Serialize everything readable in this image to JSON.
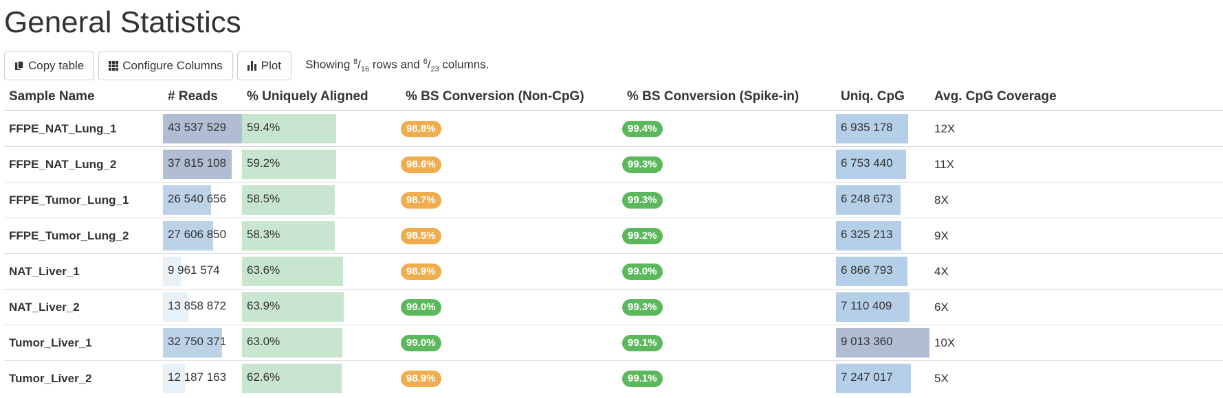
{
  "title": "General Statistics",
  "toolbar": {
    "copy_label": "Copy table",
    "configure_label": "Configure Columns",
    "plot_label": "Plot",
    "showing_prefix": "Showing ",
    "rows_shown": "8",
    "rows_total": "16",
    "rows_word": " rows and ",
    "cols_shown": "6",
    "cols_total": "23",
    "cols_word": " columns."
  },
  "columns": [
    "Sample Name",
    "# Reads",
    "% Uniquely Aligned",
    "% BS Conversion (Non-CpG)",
    "% BS Conversion (Spike-in)",
    "Uniq. CpG",
    "Avg. CpG Coverage"
  ],
  "colors": {
    "reads_bar_dark": "#b0bdd2",
    "reads_bar_mid": "#bcd2e6",
    "reads_bar_light": "#e8f0f8",
    "aligned_bar": "#c8e6cf",
    "cpg_bar": "#b5cfe8",
    "cpg_bar_max": "#b0bdd2",
    "badge_orange": "#f0ad4e",
    "badge_green": "#5cb85c"
  },
  "rows": [
    {
      "sample": "FFPE_NAT_Lung_1",
      "reads": "43 537 529",
      "reads_frac": 1.0,
      "reads_shade": "dark",
      "aligned": "59.4%",
      "aligned_frac": 0.594,
      "bs_noncpg": "98.8%",
      "noncpg_color": "orange",
      "bs_spike": "99.4%",
      "spike_color": "green",
      "uniq_cpg": "6 935 178",
      "cpg_frac": 0.77,
      "cpg_max": false,
      "coverage": "12X"
    },
    {
      "sample": "FFPE_NAT_Lung_2",
      "reads": "37 815 108",
      "reads_frac": 0.869,
      "reads_shade": "dark",
      "aligned": "59.2%",
      "aligned_frac": 0.592,
      "bs_noncpg": "98.6%",
      "noncpg_color": "orange",
      "bs_spike": "99.3%",
      "spike_color": "green",
      "uniq_cpg": "6 753 440",
      "cpg_frac": 0.749,
      "cpg_max": false,
      "coverage": "11X"
    },
    {
      "sample": "FFPE_Tumor_Lung_1",
      "reads": "26 540 656",
      "reads_frac": 0.61,
      "reads_shade": "mid",
      "aligned": "58.5%",
      "aligned_frac": 0.585,
      "bs_noncpg": "98.7%",
      "noncpg_color": "orange",
      "bs_spike": "99.3%",
      "spike_color": "green",
      "uniq_cpg": "6 248 673",
      "cpg_frac": 0.693,
      "cpg_max": false,
      "coverage": "8X"
    },
    {
      "sample": "FFPE_Tumor_Lung_2",
      "reads": "27 606 850",
      "reads_frac": 0.634,
      "reads_shade": "mid",
      "aligned": "58.3%",
      "aligned_frac": 0.583,
      "bs_noncpg": "98.5%",
      "noncpg_color": "orange",
      "bs_spike": "99.2%",
      "spike_color": "green",
      "uniq_cpg": "6 325 213",
      "cpg_frac": 0.702,
      "cpg_max": false,
      "coverage": "9X"
    },
    {
      "sample": "NAT_Liver_1",
      "reads": "9 961 574",
      "reads_frac": 0.229,
      "reads_shade": "light",
      "aligned": "63.6%",
      "aligned_frac": 0.636,
      "bs_noncpg": "98.9%",
      "noncpg_color": "orange",
      "bs_spike": "99.0%",
      "spike_color": "green",
      "uniq_cpg": "6 866 793",
      "cpg_frac": 0.762,
      "cpg_max": false,
      "coverage": "4X"
    },
    {
      "sample": "NAT_Liver_2",
      "reads": "13 858 872",
      "reads_frac": 0.318,
      "reads_shade": "light",
      "aligned": "63.9%",
      "aligned_frac": 0.639,
      "bs_noncpg": "99.0%",
      "noncpg_color": "green",
      "bs_spike": "99.3%",
      "spike_color": "green",
      "uniq_cpg": "7 110 409",
      "cpg_frac": 0.789,
      "cpg_max": false,
      "coverage": "6X"
    },
    {
      "sample": "Tumor_Liver_1",
      "reads": "32 750 371",
      "reads_frac": 0.752,
      "reads_shade": "mid",
      "aligned": "63.0%",
      "aligned_frac": 0.63,
      "bs_noncpg": "99.0%",
      "noncpg_color": "green",
      "bs_spike": "99.1%",
      "spike_color": "green",
      "uniq_cpg": "9 013 360",
      "cpg_frac": 1.0,
      "cpg_max": true,
      "coverage": "10X"
    },
    {
      "sample": "Tumor_Liver_2",
      "reads": "12 187 163",
      "reads_frac": 0.28,
      "reads_shade": "light",
      "aligned": "62.6%",
      "aligned_frac": 0.626,
      "bs_noncpg": "98.9%",
      "noncpg_color": "orange",
      "bs_spike": "99.1%",
      "spike_color": "green",
      "uniq_cpg": "7 247 017",
      "cpg_frac": 0.804,
      "cpg_max": false,
      "coverage": "5X"
    }
  ]
}
